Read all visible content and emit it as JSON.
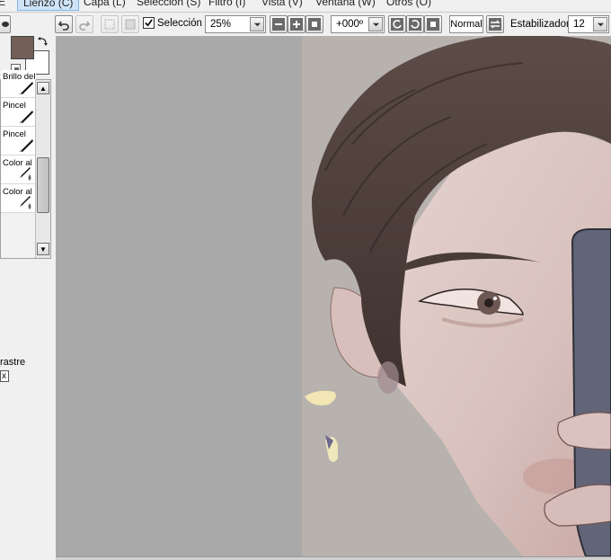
{
  "menubar": {
    "items": [
      "E",
      "Lienzo (C)",
      "Capa (L)",
      "Selección (S)",
      "Filtro (I)",
      "Vista (V)",
      "Ventana (W)",
      "Otros (O)"
    ],
    "active_index": 1
  },
  "toolbar": {
    "selection_label": "Selección",
    "selection_checked": true,
    "zoom_value": "25%",
    "rotation_value": "+000º",
    "blend_mode": "Normal",
    "stabilizer_label": "Estabilizador",
    "stabilizer_value": "12"
  },
  "colors": {
    "primary": "#735e58",
    "secondary": "#ffffff",
    "canvas_bg": "#aaa9a9",
    "menu_active": "#cfe4f7"
  },
  "brushes": {
    "items": [
      {
        "label": "Brillo del",
        "icon": "pen-icon"
      },
      {
        "label": "Pincel",
        "icon": "pen-icon"
      },
      {
        "label": "Pincel",
        "icon": "pen-icon"
      },
      {
        "label": "Color al",
        "icon": "pen-drop-icon"
      },
      {
        "label": "Color al",
        "icon": "pen-drop-icon"
      }
    ]
  },
  "panel": {
    "drag_label": "rastre",
    "drag_box": "x"
  }
}
